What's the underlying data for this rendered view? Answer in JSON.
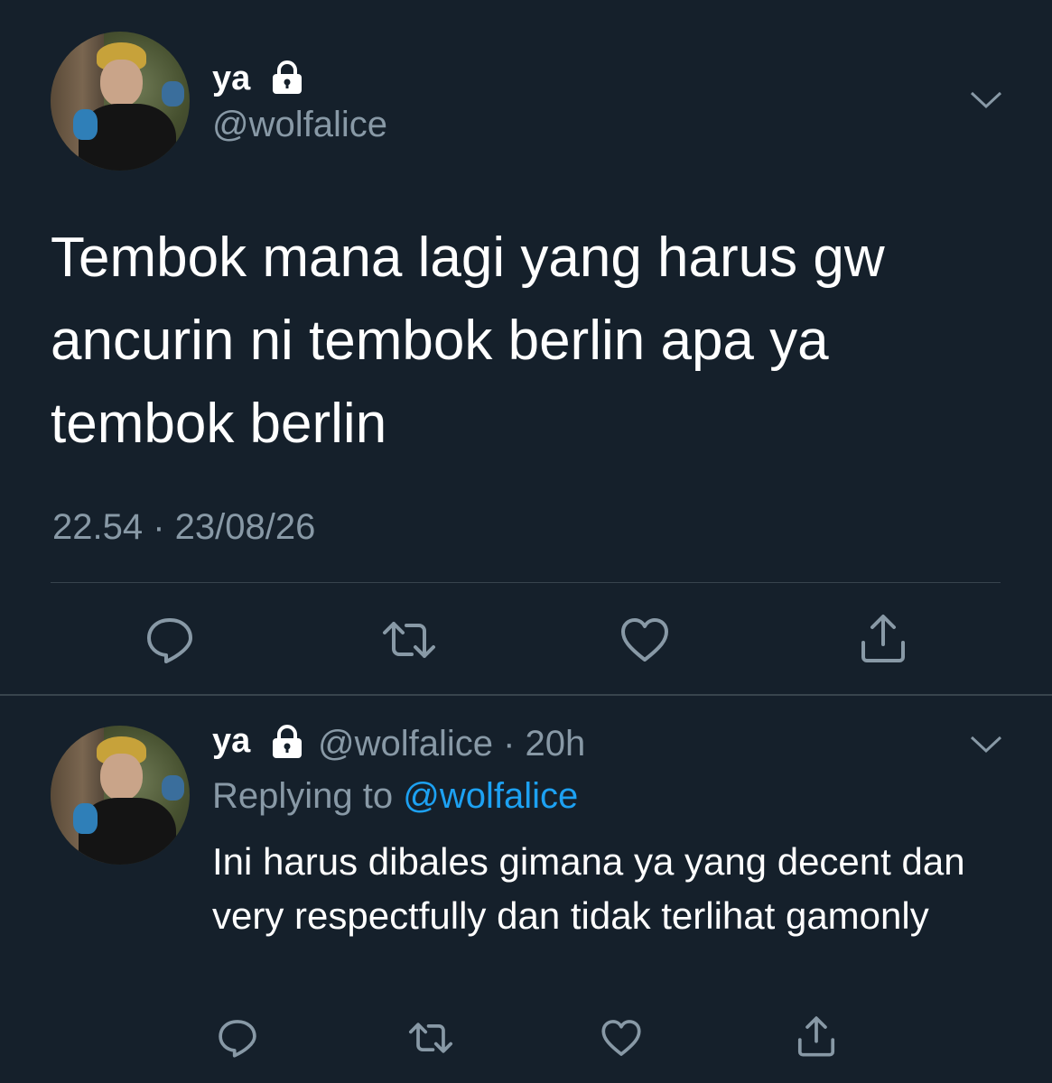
{
  "colors": {
    "background": "#15202b",
    "text_primary": "#ffffff",
    "text_secondary": "#8899a6",
    "link": "#1da1f2",
    "divider": "#38444d"
  },
  "main_tweet": {
    "display_name": "ya",
    "handle": "@wolfalice",
    "text": "Tembok mana lagi yang harus gw\nancurin ni tembok berlin apa ya\ntembok berlin",
    "timestamp": "22.54 · 23/08/26",
    "icons": {
      "lock": "lock-icon",
      "menu": "chevron-down-icon",
      "reply": "reply-icon",
      "retweet": "retweet-icon",
      "like": "heart-icon",
      "share": "share-icon"
    }
  },
  "reply_tweet": {
    "display_name": "ya",
    "handle_time": "@wolfalice · 20h",
    "replying_prefix": "Replying to ",
    "replying_to": "@wolfalice",
    "text": "Ini harus dibales gimana ya yang decent dan very respectfully dan tidak terlihat gamonly"
  }
}
